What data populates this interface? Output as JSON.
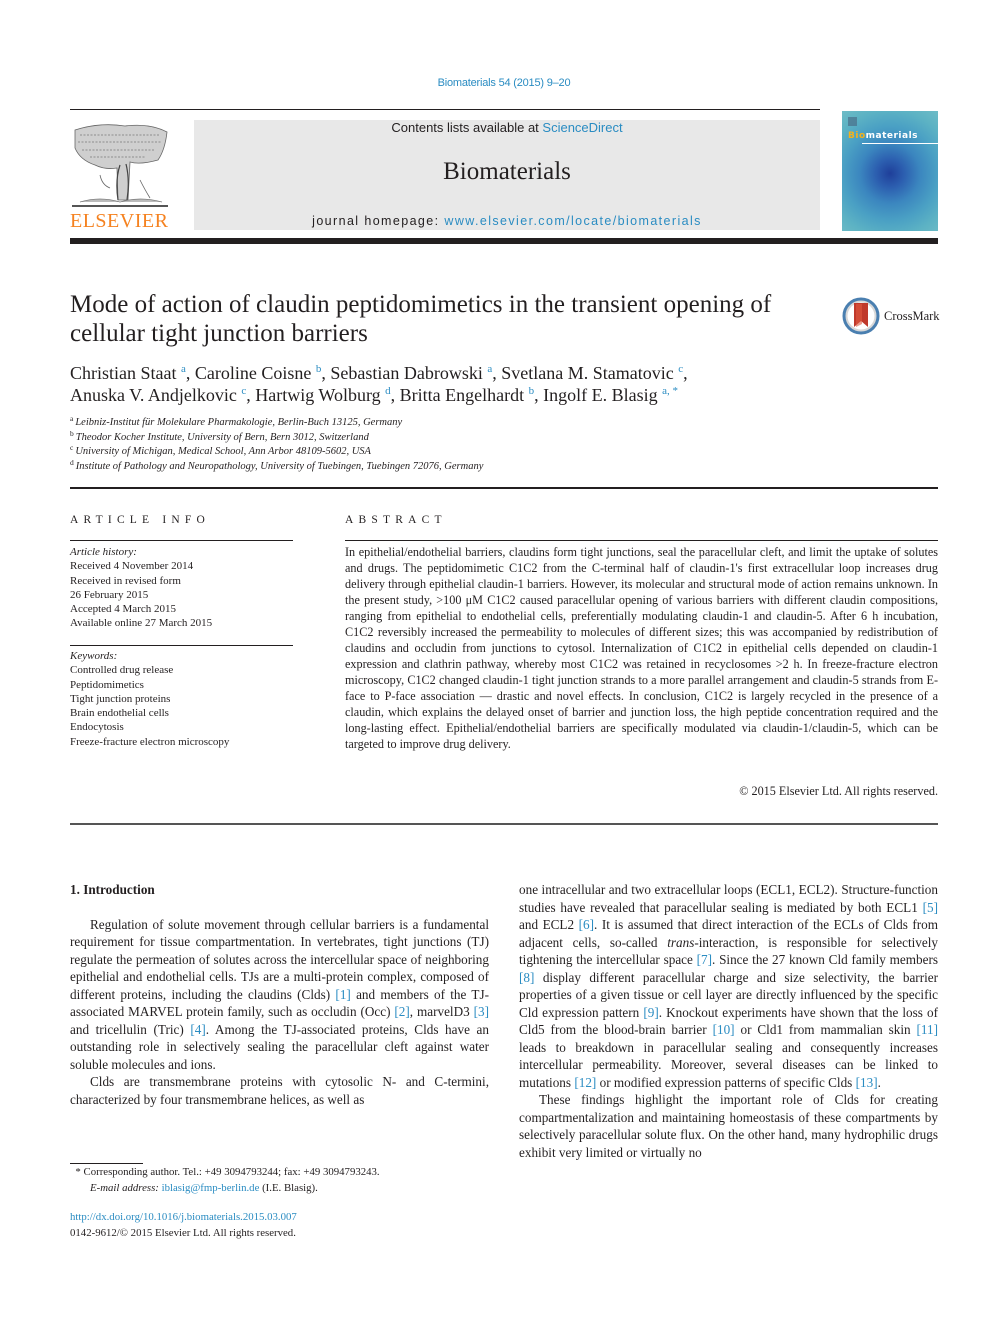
{
  "header": {
    "journal_ref": "Biomaterials 54 (2015) 9–20",
    "contents_prefix": "Contents lists available at ",
    "contents_link": "ScienceDirect",
    "journal_name": "Biomaterials",
    "homepage_prefix": "journal homepage: ",
    "homepage_link": "www.elsevier.com/locate/biomaterials",
    "publisher_logo_text": "ELSEVIER",
    "cover_title_accent": "Bio",
    "cover_title_rest": "materials",
    "brand_color": "#f58220",
    "link_color": "#2a8cc2"
  },
  "article": {
    "title": "Mode of action of claudin peptidomimetics in the transient opening of cellular tight junction barriers",
    "crossmark_label": "CrossMark",
    "authors": [
      {
        "name": "Christian Staat",
        "aff": "a",
        "sep": ", "
      },
      {
        "name": "Caroline Coisne",
        "aff": "b",
        "sep": ", "
      },
      {
        "name": "Sebastian Dabrowski",
        "aff": "a",
        "sep": ", "
      },
      {
        "name": "Svetlana M. Stamatovic",
        "aff": "c",
        "sep": ","
      },
      {
        "name": "Anuska V. Andjelkovic",
        "aff": "c",
        "sep": ", "
      },
      {
        "name": "Hartwig Wolburg",
        "aff": "d",
        "sep": ", "
      },
      {
        "name": "Britta Engelhardt",
        "aff": "b",
        "sep": ", "
      },
      {
        "name": "Ingolf E. Blasig",
        "aff": "a, *",
        "sep": ""
      }
    ],
    "affiliations": [
      {
        "key": "a",
        "text": "Leibniz-Institut für Molekulare Pharmakologie, Berlin-Buch 13125, Germany"
      },
      {
        "key": "b",
        "text": "Theodor Kocher Institute, University of Bern, Bern 3012, Switzerland"
      },
      {
        "key": "c",
        "text": "University of Michigan, Medical School, Ann Arbor 48109-5602, USA"
      },
      {
        "key": "d",
        "text": "Institute of Pathology and Neuropathology, University of Tuebingen, Tuebingen 72076, Germany"
      }
    ]
  },
  "article_info": {
    "heading": "ARTICLE INFO",
    "history_label": "Article history:",
    "history": [
      "Received 4 November 2014",
      "Received in revised form",
      "26 February 2015",
      "Accepted 4 March 2015",
      "Available online 27 March 2015"
    ],
    "keywords_label": "Keywords:",
    "keywords": [
      "Controlled drug release",
      "Peptidomimetics",
      "Tight junction proteins",
      "Brain endothelial cells",
      "Endocytosis",
      "Freeze-fracture electron microscopy"
    ]
  },
  "abstract": {
    "heading": "ABSTRACT",
    "text": "In epithelial/endothelial barriers, claudins form tight junctions, seal the paracellular cleft, and limit the uptake of solutes and drugs. The peptidomimetic C1C2 from the C-terminal half of claudin-1's first extracellular loop increases drug delivery through epithelial claudin-1 barriers. However, its molecular and structural mode of action remains unknown. In the present study, >100 μM C1C2 caused paracellular opening of various barriers with different claudin compositions, ranging from epithelial to endothelial cells, preferentially modulating claudin-1 and claudin-5. After 6 h incubation, C1C2 reversibly increased the permeability to molecules of different sizes; this was accompanied by redistribution of claudins and occludin from junctions to cytosol. Internalization of C1C2 in epithelial cells depended on claudin-1 expression and clathrin pathway, whereby most C1C2 was retained in recyclosomes >2 h. In freeze-fracture electron microscopy, C1C2 changed claudin-1 tight junction strands to a more parallel arrangement and claudin-5 strands from E-face to P-face association — drastic and novel effects. In conclusion, C1C2 is largely recycled in the presence of a claudin, which explains the delayed onset of barrier and junction loss, the high peptide concentration required and the long-lasting effect. Epithelial/endothelial barriers are specifically modulated via claudin-1/claudin-5, which can be targeted to improve drug delivery.",
    "copyright": "© 2015 Elsevier Ltd. All rights reserved."
  },
  "body": {
    "section_title": "1.  Introduction",
    "left_paragraphs": [
      [
        {
          "t": "Regulation of solute movement through cellular barriers is a fundamental requirement for tissue compartmentation. In vertebrates, tight junctions (TJ) regulate the permeation of solutes across the intercellular space of neighboring epithelial and endothelial cells. TJs are a multi-protein complex, composed of different proteins, including the claudins (Clds) "
        },
        {
          "ref": "[1]"
        },
        {
          "t": " and members of the TJ-associated MARVEL protein family, such as occludin (Occ) "
        },
        {
          "ref": "[2]"
        },
        {
          "t": ", marvelD3 "
        },
        {
          "ref": "[3]"
        },
        {
          "t": " and tricellulin (Tric) "
        },
        {
          "ref": "[4]"
        },
        {
          "t": ". Among the TJ-associated proteins, Clds have an outstanding role in selectively sealing the paracellular cleft against water soluble molecules and ions."
        }
      ],
      [
        {
          "t": "Clds are transmembrane proteins with cytosolic N- and C-termini, characterized by four transmembrane helices, as well as"
        }
      ]
    ],
    "right_paragraphs": [
      [
        {
          "t": "one intracellular and two extracellular loops (ECL1, ECL2). Structure-function studies have revealed that paracellular sealing is mediated by both ECL1 "
        },
        {
          "ref": "[5]"
        },
        {
          "t": " and ECL2 "
        },
        {
          "ref": "[6]"
        },
        {
          "t": ". It is assumed that direct interaction of the ECLs of Clds from adjacent cells, so-called "
        },
        {
          "it": "trans"
        },
        {
          "t": "-interaction, is responsible for selectively tightening the intercellular space "
        },
        {
          "ref": "[7]"
        },
        {
          "t": ". Since the 27 known Cld family members "
        },
        {
          "ref": "[8]"
        },
        {
          "t": " display different paracellular charge and size selectivity, the barrier properties of a given tissue or cell layer are directly influenced by the specific Cld expression pattern "
        },
        {
          "ref": "[9]"
        },
        {
          "t": ". Knockout experiments have shown that the loss of Cld5 from the blood-brain barrier "
        },
        {
          "ref": "[10]"
        },
        {
          "t": " or Cld1 from mammalian skin "
        },
        {
          "ref": "[11]"
        },
        {
          "t": " leads to breakdown in paracellular sealing and consequently increases intercellular permeability. Moreover, several diseases can be linked to mutations "
        },
        {
          "ref": "[12]"
        },
        {
          "t": " or modified expression patterns of specific Clds "
        },
        {
          "ref": "[13]"
        },
        {
          "t": "."
        }
      ],
      [
        {
          "t": "These findings highlight the important role of Clds for creating compartmentalization and maintaining homeostasis of these compartments by selectively paracellular solute flux. On the other hand, many hydrophilic drugs exhibit very limited or virtually no"
        }
      ]
    ]
  },
  "footnote": {
    "marker": "*",
    "corresponding": "Corresponding author. Tel.: +49 3094793244; fax: +49 3094793243.",
    "email_label": "E-mail address:",
    "email": "iblasig@fmp-berlin.de",
    "email_suffix": " (I.E. Blasig).",
    "doi": "http://dx.doi.org/10.1016/j.biomaterials.2015.03.007",
    "issn_copyright": "0142-9612/© 2015 Elsevier Ltd. All rights reserved."
  }
}
